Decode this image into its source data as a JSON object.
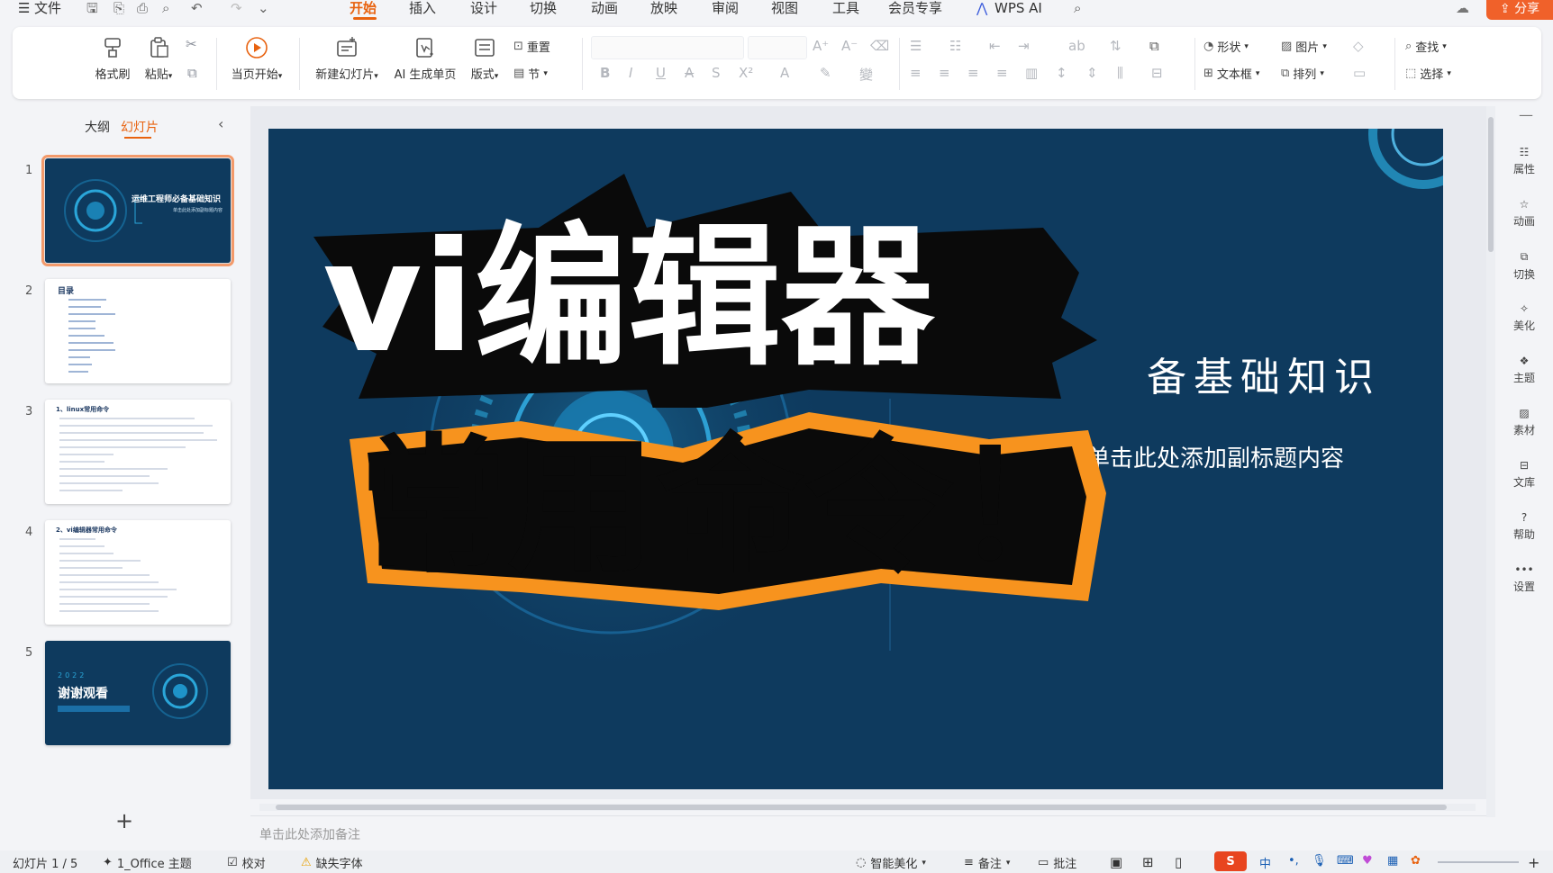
{
  "menu": {
    "file": "文件",
    "tabs": [
      "开始",
      "插入",
      "设计",
      "切换",
      "动画",
      "放映",
      "审阅",
      "视图",
      "工具",
      "会员专享"
    ],
    "active_tab": "开始",
    "wps_ai": "WPS AI",
    "share": "分享"
  },
  "ribbon": {
    "format_painter": "格式刷",
    "paste": "粘贴",
    "play_from_current": "当页开始",
    "new_slide": "新建幻灯片",
    "ai_generate": "AI 生成单页",
    "layout": "版式",
    "reset": "重置",
    "section": "节",
    "shape": "形状",
    "picture": "图片",
    "find": "查找",
    "textbox": "文本框",
    "arrange": "排列",
    "select": "选择"
  },
  "left_panel": {
    "tab_outline": "大纲",
    "tab_slides": "幻灯片",
    "active": "幻灯片",
    "thumbnails": [
      {
        "num": "1",
        "title": "运维工程师必备基础知识",
        "subtitle": "单击此处添加副标题内容"
      },
      {
        "num": "2",
        "title": "目录"
      },
      {
        "num": "3",
        "title": "1、linux常用命令"
      },
      {
        "num": "4",
        "title": "2、vi编辑器常用命令"
      },
      {
        "num": "5",
        "year": "2022",
        "title": "谢谢观看"
      }
    ]
  },
  "slide": {
    "title_partial": "备基础知识",
    "subtitle": "单击此处添加副标题内容",
    "overlay_line1": "vi编辑器",
    "overlay_line2": "常用命令！"
  },
  "notes_placeholder": "单击此处添加备注",
  "right_sidebar": [
    "属性",
    "动画",
    "切换",
    "美化",
    "主题",
    "素材",
    "文库",
    "帮助",
    "设置"
  ],
  "status": {
    "slide_count": "幻灯片 1 / 5",
    "theme": "1_Office 主题",
    "proofread": "校对",
    "missing_font": "缺失字体",
    "smart_beautify": "智能美化",
    "notes": "备注",
    "comments": "批注"
  },
  "ime": {
    "lang": "中"
  },
  "colors": {
    "accent": "#e8620f",
    "slide_bg": "#0e3a5e",
    "overlay_orange": "#f7931e",
    "thumb_selected": "#f39a6b"
  }
}
